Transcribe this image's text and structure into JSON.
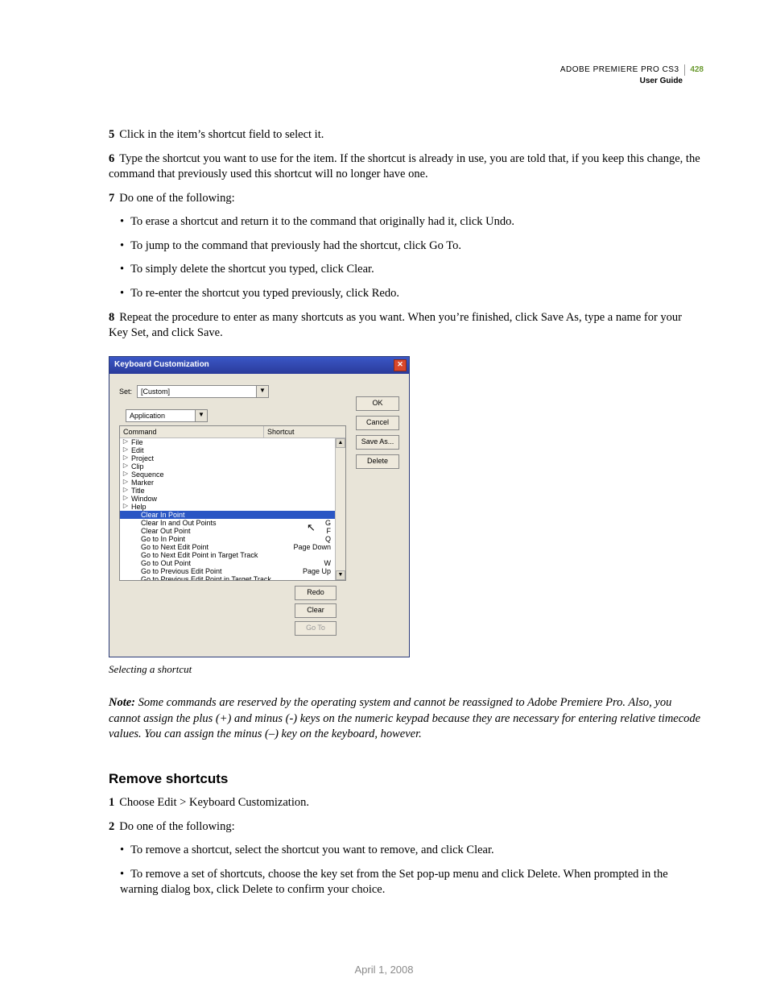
{
  "header": {
    "product": "ADOBE PREMIERE PRO CS3",
    "subtitle": "User Guide",
    "page_number": "428"
  },
  "steps_a": {
    "s5": {
      "n": "5",
      "t": "Click in the item’s shortcut field to select it."
    },
    "s6": {
      "n": "6",
      "t": "Type the shortcut you want to use for the item. If the shortcut is already in use, you are told that, if you keep this change, the command that previously used this shortcut will no longer have one."
    },
    "s7": {
      "n": "7",
      "t": "Do one of the following:"
    }
  },
  "bullets_a": {
    "b1": "To erase a shortcut and return it to the command that originally had it, click Undo.",
    "b2": "To jump to the command that previously had the shortcut, click Go To.",
    "b3": "To simply delete the shortcut you typed, click Clear.",
    "b4": "To re-enter the shortcut you typed previously, click Redo."
  },
  "steps_b": {
    "s8": {
      "n": "8",
      "t": "Repeat the procedure to enter as many shortcuts as you want. When you’re finished, click Save As, type a name for your Key Set, and click Save."
    }
  },
  "dialog": {
    "title": "Keyboard Customization",
    "set_label": "Set:",
    "set_value": "[Custom]",
    "scope_value": "Application",
    "col_command": "Command",
    "col_shortcut": "Shortcut",
    "tree": {
      "r0": {
        "label": "File"
      },
      "r1": {
        "label": "Edit"
      },
      "r2": {
        "label": "Project"
      },
      "r3": {
        "label": "Clip"
      },
      "r4": {
        "label": "Sequence"
      },
      "r5": {
        "label": "Marker"
      },
      "r6": {
        "label": "Title"
      },
      "r7": {
        "label": "Window"
      },
      "r8": {
        "label": "Help"
      },
      "r9": {
        "label": "Clear In Point"
      },
      "r10": {
        "label": "Clear In and Out Points",
        "sc": "G"
      },
      "r11": {
        "label": "Clear Out Point",
        "sc": "F"
      },
      "r12": {
        "label": "Go to In Point",
        "sc": "Q"
      },
      "r13": {
        "label": "Go to Next Edit Point",
        "sc": "Page Down"
      },
      "r14": {
        "label": "Go to Next Edit Point in Target Track"
      },
      "r15": {
        "label": "Go to Out Point",
        "sc": "W"
      },
      "r16": {
        "label": "Go to Previous Edit Point",
        "sc": "Page Up"
      },
      "r17": {
        "label": "Go to Previous Edit Point in Target Track"
      }
    },
    "btn_ok": "OK",
    "btn_cancel": "Cancel",
    "btn_saveas": "Save As...",
    "btn_delete": "Delete",
    "btn_redo": "Redo",
    "btn_clear": "Clear",
    "btn_goto": "Go To"
  },
  "figure_caption": "Selecting a shortcut",
  "note": {
    "label": "Note:",
    "text": " Some commands are reserved by the operating system and cannot be reassigned to Adobe Premiere Pro. Also, you cannot assign the plus (+) and minus (-) keys on the numeric keypad because they are necessary for entering relative timecode values. You can assign the minus (–) key on the keyboard, however."
  },
  "section2": {
    "title": "Remove shortcuts",
    "s1": {
      "n": "1",
      "t": "Choose Edit > Keyboard Customization."
    },
    "s2": {
      "n": "2",
      "t": "Do one of the following:"
    },
    "b1": "To remove a shortcut, select the shortcut you want to remove, and click Clear.",
    "b2": "To remove a set of shortcuts, choose the key set from the Set pop-up menu and click Delete. When prompted in the warning dialog box, click Delete to confirm your choice."
  },
  "footer_date": "April 1, 2008"
}
